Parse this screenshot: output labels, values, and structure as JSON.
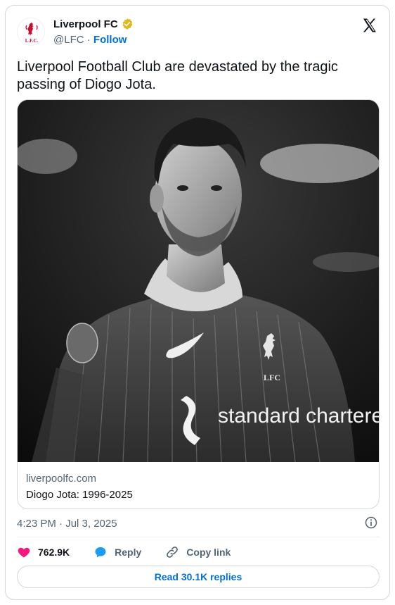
{
  "author": {
    "display_name": "Liverpool FC",
    "handle": "@LFC",
    "separator": " · ",
    "follow_label": "Follow",
    "avatar_crest_text": "L.F.C."
  },
  "tweet": {
    "text": "Liverpool Football Club are devastated by the tragic\npassing of Diogo Jota.",
    "timestamp": "4:23 PM · Jul 3, 2025"
  },
  "media": {
    "image": "black-and-white photo of player in Liverpool kit",
    "jersey_sponsor": "standard chartered",
    "link_domain": "liverpoolfc.com",
    "link_title": "Diogo Jota: 1996-2025"
  },
  "actions": {
    "likes": "762.9K",
    "reply_label": "Reply",
    "copy_link_label": "Copy link",
    "read_replies_label": "Read 30.1K replies"
  },
  "colors": {
    "link_blue": "#006fd6",
    "like_pink": "#f91880",
    "muted_text": "#536471",
    "verified_gold": "#e2b719",
    "crest_red": "#c8102e"
  }
}
